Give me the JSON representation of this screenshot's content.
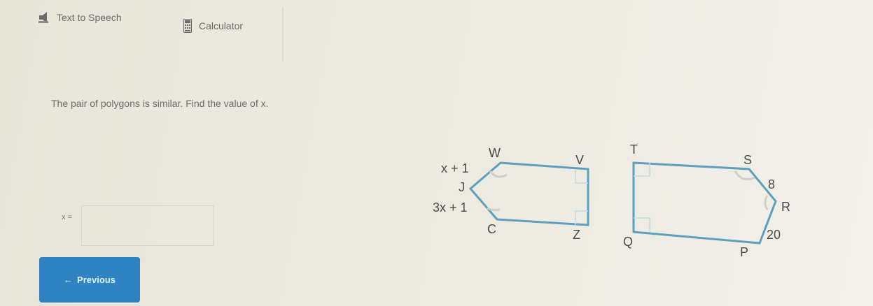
{
  "toolbar": {
    "text_to_speech_label": "Text to Speech",
    "calculator_label": "Calculator"
  },
  "question": {
    "prompt": "The pair of polygons is similar. Find the value of x."
  },
  "answer": {
    "label": "x =",
    "value": ""
  },
  "navigation": {
    "previous_label": "Previous",
    "previous_arrow": "←"
  },
  "figure": {
    "left_polygon": {
      "vertices": [
        "W",
        "V",
        "Z",
        "C",
        "J"
      ],
      "side_labels": [
        "x + 1",
        "3x + 1"
      ]
    },
    "right_polygon": {
      "vertices": [
        "T",
        "S",
        "R",
        "P",
        "Q"
      ],
      "side_labels": [
        "8",
        "20"
      ]
    },
    "stroke_color": "#5d9fbd"
  }
}
